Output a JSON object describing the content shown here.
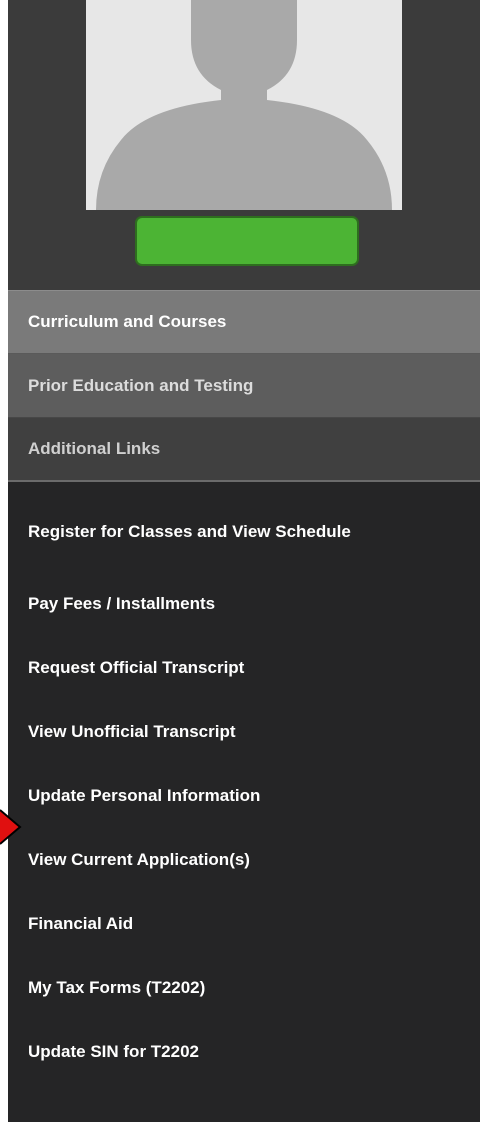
{
  "sidebar": {
    "name_button_label": "",
    "sections": [
      {
        "label": "Curriculum and Courses"
      },
      {
        "label": "Prior Education and Testing"
      },
      {
        "label": "Additional Links"
      }
    ],
    "links": [
      {
        "label": "Register for Classes and View Schedule"
      },
      {
        "label": "Pay Fees / Installments"
      },
      {
        "label": "Request Official Transcript"
      },
      {
        "label": "View Unofficial Transcript"
      },
      {
        "label": "Update Personal Information"
      },
      {
        "label": "View Current Application(s)"
      },
      {
        "label": "Financial Aid"
      },
      {
        "label": "My Tax Forms (T2202)"
      },
      {
        "label": "Update SIN for T2202"
      }
    ]
  },
  "colors": {
    "sidebar_bg": "#252526",
    "profile_bg": "#3b3b3b",
    "name_button": "#4cb434",
    "highlight_arrow": "#e01010"
  },
  "icons": {
    "avatar": "user-silhouette-icon",
    "pointer": "red-arrow-icon"
  }
}
